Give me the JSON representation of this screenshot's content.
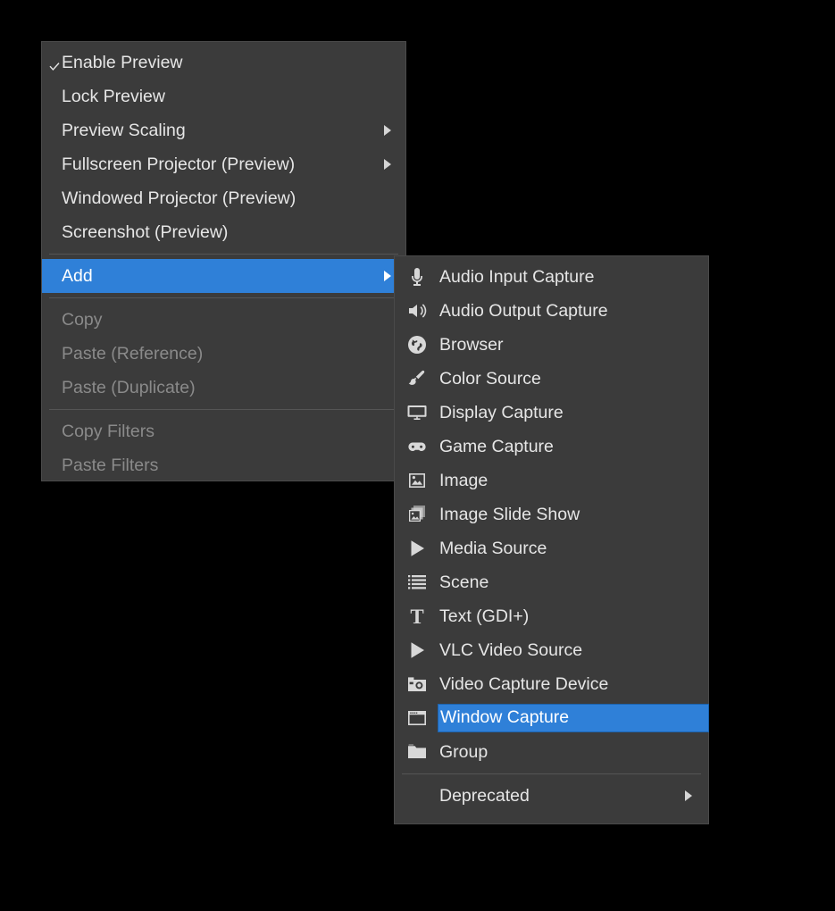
{
  "app": "OBS Studio preview context menu",
  "colors": {
    "panel_bg": "#3b3b3b",
    "highlight": "#2f80d8",
    "text": "#e6e6e6",
    "text_disabled": "#8a8a8a",
    "separator": "#555555",
    "page_bg": "#000000"
  },
  "primary_menu": {
    "items": [
      {
        "label": "Enable Preview",
        "checked": true,
        "disabled": false,
        "has_submenu": false,
        "highlighted": false
      },
      {
        "label": "Lock Preview",
        "checked": false,
        "disabled": false,
        "has_submenu": false,
        "highlighted": false
      },
      {
        "label": "Preview Scaling",
        "checked": false,
        "disabled": false,
        "has_submenu": true,
        "highlighted": false
      },
      {
        "label": "Fullscreen Projector (Preview)",
        "checked": false,
        "disabled": false,
        "has_submenu": true,
        "highlighted": false
      },
      {
        "label": "Windowed Projector (Preview)",
        "checked": false,
        "disabled": false,
        "has_submenu": false,
        "highlighted": false
      },
      {
        "label": "Screenshot (Preview)",
        "checked": false,
        "disabled": false,
        "has_submenu": false,
        "highlighted": false
      },
      {
        "separator": true
      },
      {
        "label": "Add",
        "checked": false,
        "disabled": false,
        "has_submenu": true,
        "highlighted": true
      },
      {
        "separator": true
      },
      {
        "label": "Copy",
        "checked": false,
        "disabled": true,
        "has_submenu": false,
        "highlighted": false
      },
      {
        "label": "Paste (Reference)",
        "checked": false,
        "disabled": true,
        "has_submenu": false,
        "highlighted": false
      },
      {
        "label": "Paste (Duplicate)",
        "checked": false,
        "disabled": true,
        "has_submenu": false,
        "highlighted": false
      },
      {
        "separator": true
      },
      {
        "label": "Copy Filters",
        "checked": false,
        "disabled": true,
        "has_submenu": false,
        "highlighted": false
      },
      {
        "label": "Paste Filters",
        "checked": false,
        "disabled": true,
        "has_submenu": false,
        "highlighted": false
      }
    ]
  },
  "add_submenu": {
    "items": [
      {
        "label": "Audio Input Capture",
        "icon": "microphone-icon",
        "highlighted": false
      },
      {
        "label": "Audio Output Capture",
        "icon": "speaker-icon",
        "highlighted": false
      },
      {
        "label": "Browser",
        "icon": "globe-icon",
        "highlighted": false
      },
      {
        "label": "Color Source",
        "icon": "paintbrush-icon",
        "highlighted": false
      },
      {
        "label": "Display Capture",
        "icon": "monitor-icon",
        "highlighted": false
      },
      {
        "label": "Game Capture",
        "icon": "gamepad-icon",
        "highlighted": false
      },
      {
        "label": "Image",
        "icon": "image-icon",
        "highlighted": false
      },
      {
        "label": "Image Slide Show",
        "icon": "image-stack-icon",
        "highlighted": false
      },
      {
        "label": "Media Source",
        "icon": "play-icon",
        "highlighted": false
      },
      {
        "label": "Scene",
        "icon": "list-icon",
        "highlighted": false
      },
      {
        "label": "Text (GDI+)",
        "icon": "text-t-icon",
        "highlighted": false
      },
      {
        "label": "VLC Video Source",
        "icon": "play-icon",
        "highlighted": false
      },
      {
        "label": "Video Capture Device",
        "icon": "camera-icon",
        "highlighted": false
      },
      {
        "label": "Window Capture",
        "icon": "window-icon",
        "highlighted": true
      },
      {
        "label": "Group",
        "icon": "folder-icon",
        "highlighted": false
      },
      {
        "separator": true
      },
      {
        "label": "Deprecated",
        "icon": null,
        "highlighted": false,
        "has_submenu": true
      }
    ]
  }
}
